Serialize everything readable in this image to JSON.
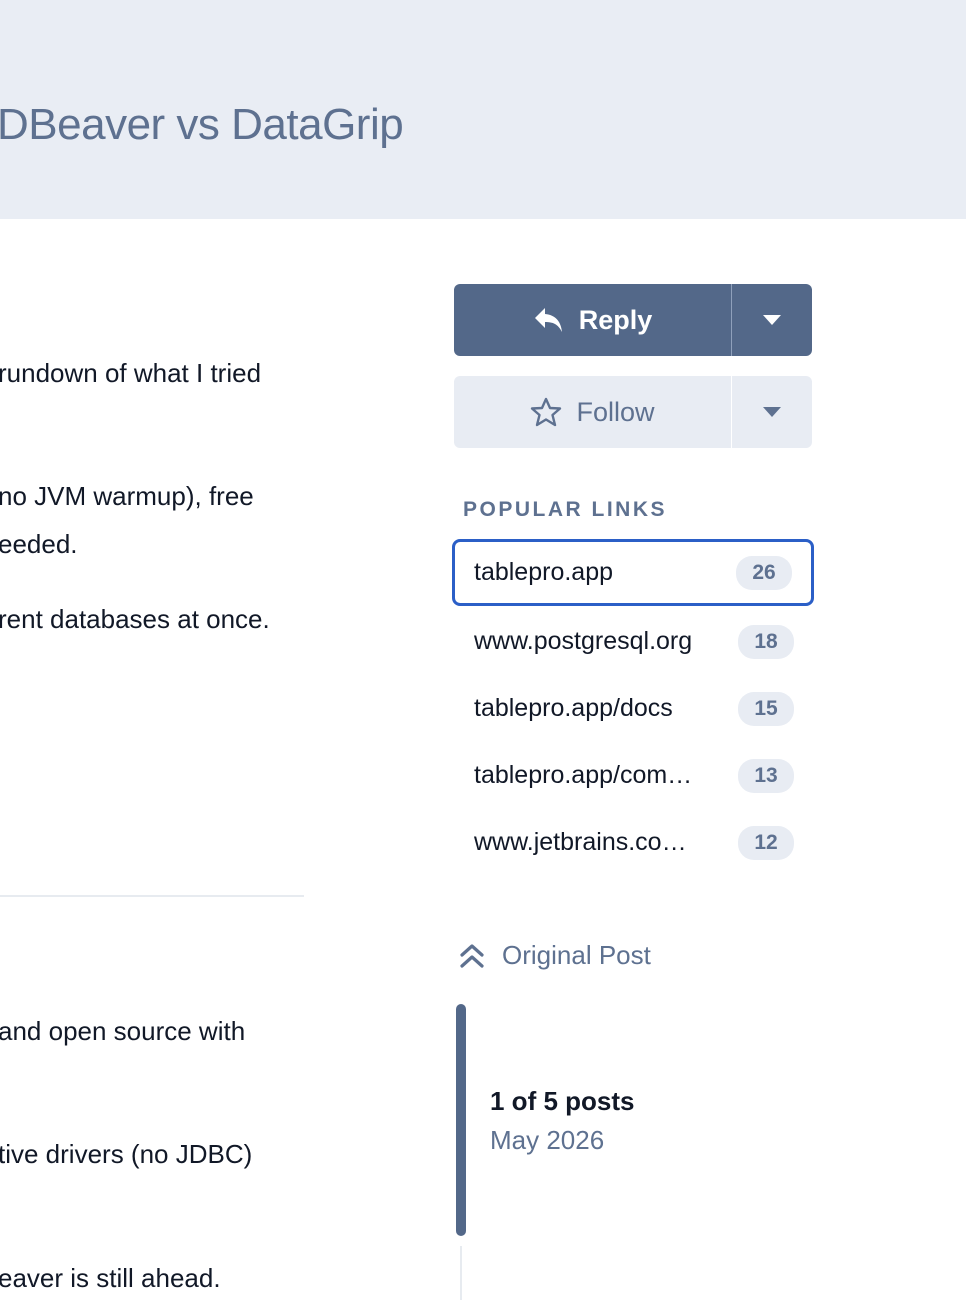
{
  "topic": {
    "title": "DBeaver vs DataGrip"
  },
  "post_lines": [
    " rundown of what I tried",
    " no JVM warmup), free",
    "eeded.",
    "rent databases at once.",
    " and open source with",
    "tive drivers (no JDBC)",
    "eaver is still ahead."
  ],
  "actions": {
    "reply_label": "Reply",
    "follow_label": "Follow"
  },
  "popular_links": {
    "heading": "POPULAR LINKS",
    "items": [
      {
        "label": "tablepro.app",
        "count": "26"
      },
      {
        "label": "www.postgresql.org",
        "count": "18"
      },
      {
        "label": "tablepro.app/docs",
        "count": "15"
      },
      {
        "label": "tablepro.app/com…",
        "count": "13"
      },
      {
        "label": "www.jetbrains.co…",
        "count": "12"
      }
    ]
  },
  "timeline": {
    "original_post_label": "Original Post",
    "position": "1 of 5 posts",
    "date": "May 2026"
  },
  "colors": {
    "accent": "#536889",
    "header_bg": "#e9edf4",
    "focus_ring": "#2b5fc7"
  }
}
